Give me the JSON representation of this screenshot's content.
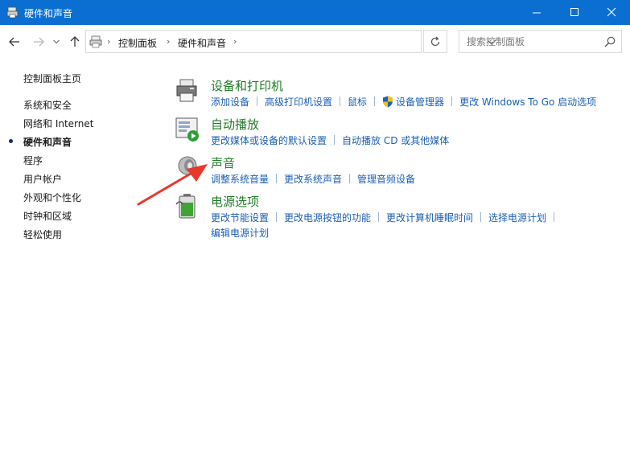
{
  "window": {
    "title": "硬件和声音"
  },
  "address": {
    "crumbs": [
      "控制面板",
      "硬件和声音"
    ]
  },
  "search": {
    "placeholder": "搜索控制面板"
  },
  "sidebar": {
    "home": "控制面板主页",
    "items": [
      {
        "label": "系统和安全",
        "current": false
      },
      {
        "label": "网络和 Internet",
        "current": false
      },
      {
        "label": "硬件和声音",
        "current": true
      },
      {
        "label": "程序",
        "current": false
      },
      {
        "label": "用户帐户",
        "current": false
      },
      {
        "label": "外观和个性化",
        "current": false
      },
      {
        "label": "时钟和区域",
        "current": false
      },
      {
        "label": "轻松使用",
        "current": false
      }
    ]
  },
  "categories": [
    {
      "title": "设备和打印机",
      "icon": "printer-icon",
      "links": [
        "添加设备",
        "高级打印机设置",
        "鼠标",
        "设备管理器",
        "更改 Windows To Go 启动选项"
      ]
    },
    {
      "title": "自动播放",
      "icon": "autoplay-icon",
      "links": [
        "更改媒体或设备的默认设置",
        "自动播放 CD 或其他媒体"
      ]
    },
    {
      "title": "声音",
      "icon": "speaker-icon",
      "links": [
        "调整系统音量",
        "更改系统声音",
        "管理音频设备"
      ]
    },
    {
      "title": "电源选项",
      "icon": "battery-icon",
      "links": [
        "更改节能设置",
        "更改电源按钮的功能",
        "更改计算机睡眠时间",
        "选择电源计划",
        "编辑电源计划"
      ]
    }
  ],
  "colors": {
    "titlebar": "#0b6fd1",
    "category_title": "#1e7d25",
    "link": "#1b5fb3",
    "annotation_arrow": "#e8382b"
  }
}
